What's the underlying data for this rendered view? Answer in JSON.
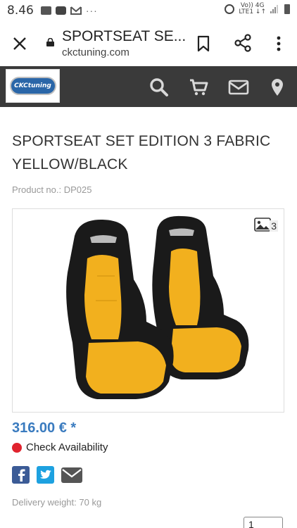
{
  "status_bar": {
    "time": "8.46",
    "dots": "···",
    "network_top": "Vo)) 4G",
    "network_bottom": "LTE1 ↓↑"
  },
  "browser": {
    "page_title": "SPORTSEAT SE...",
    "domain": "ckctuning.com"
  },
  "site": {
    "logo_text": "CKCtuning",
    "header_color": "#3a3a3a"
  },
  "product": {
    "title": "SPORTSEAT SET EDITION 3 FABRIC YELLOW/BLACK",
    "product_no": "Product no.: DP025",
    "image_count": "3",
    "price": "316.00 € *",
    "availability": "Check Availability",
    "delivery_weight": "Delivery weight: 70 kg",
    "quantity": "1"
  },
  "colors": {
    "price": "#3a7bbf",
    "availability_dot": "#e0232e",
    "facebook": "#3b5b96",
    "twitter": "#1da1e0",
    "seat_yellow": "#f2b01e",
    "seat_black": "#1a1a1a"
  },
  "icons": [
    "close-icon",
    "lock-icon",
    "bookmark-icon",
    "share-icon",
    "more-vert-icon",
    "search-icon",
    "cart-icon",
    "mail-icon",
    "location-icon",
    "gallery-icon",
    "facebook-icon",
    "twitter-icon",
    "email-share-icon"
  ]
}
